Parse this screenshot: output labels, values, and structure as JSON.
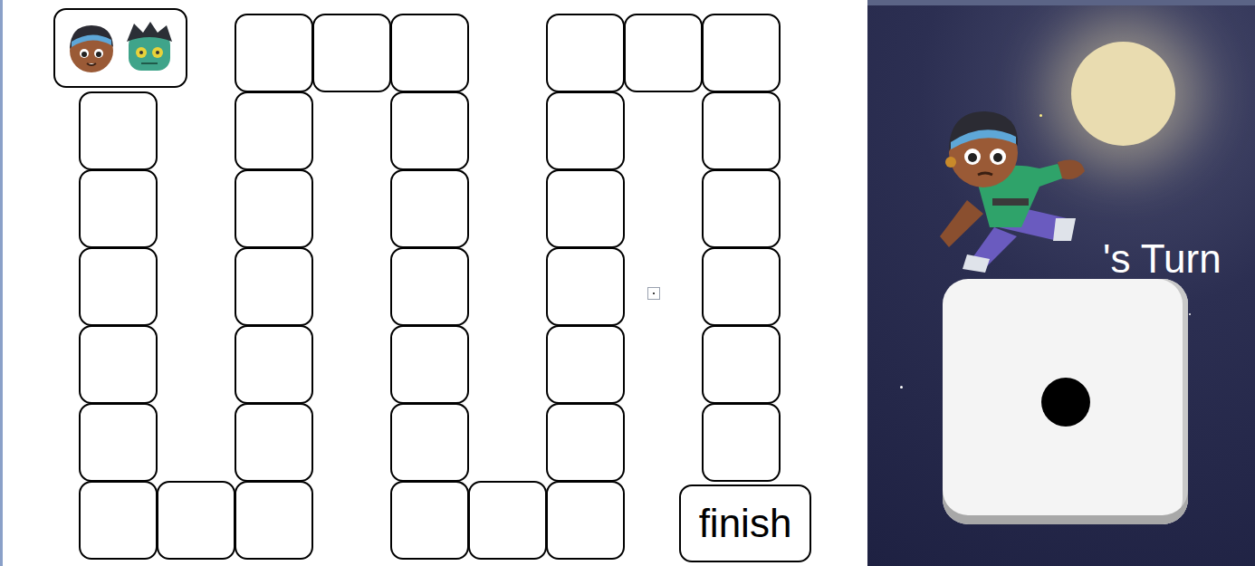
{
  "board": {
    "finish": {
      "label": "finish"
    }
  },
  "tokens": [
    {
      "position": 0
    },
    {
      "position": 0
    }
  ],
  "turn": {
    "label": "'s Turn"
  },
  "dice": {
    "pips": 1
  }
}
